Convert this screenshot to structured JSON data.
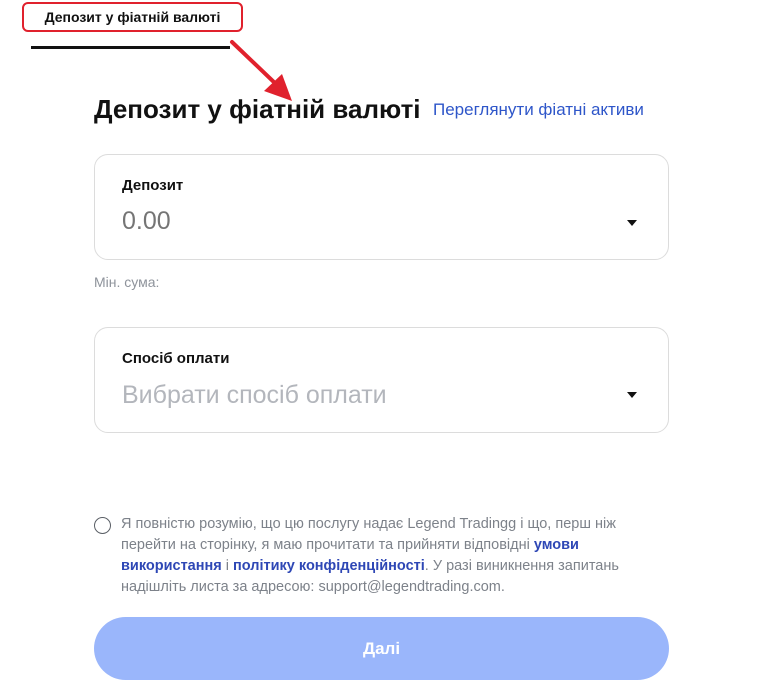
{
  "tab": {
    "label": "Депозит у фіатній валюті"
  },
  "header": {
    "title": "Депозит у фіатній валюті",
    "view_link": "Переглянути фіатні активи"
  },
  "deposit": {
    "label": "Депозит",
    "placeholder": "0.00",
    "min_sum_label": "Мін. сума:"
  },
  "payment": {
    "label": "Спосіб оплати",
    "placeholder": "Вибрати спосіб оплати"
  },
  "terms": {
    "text_1": "Я повністю розумію, що цю послугу надає Legend Tradingg і що, перш ніж перейти на сторінку, я маю прочитати та прийняти відповідні ",
    "terms_link": "умови використання",
    "connector": " і ",
    "privacy_link": "політику конфіденційності",
    "text_2": ". У разі виникнення запитань надішліть листа за адресою: support@legendtrading.com."
  },
  "actions": {
    "next_label": "Далі"
  },
  "colors": {
    "accent_link": "#2e56c9",
    "annotation_red": "#e0212d",
    "button_disabled": "#9ab6fb"
  },
  "icons": {
    "dropdown": "caret-down-icon",
    "annotation": "red-arrow-icon"
  }
}
